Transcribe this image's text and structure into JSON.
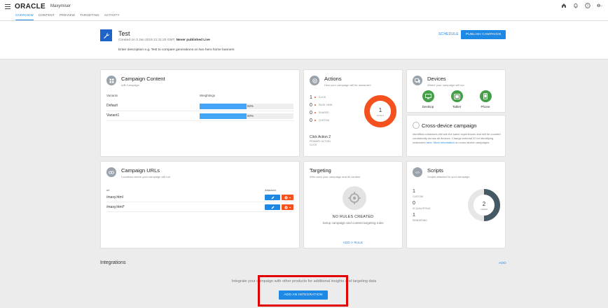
{
  "topbar": {
    "logo": "ORACLE",
    "product": "Maxymiser",
    "tabs": [
      "OVERVIEW",
      "CONTENT",
      "PREVIEW",
      "TARGETING",
      "ACTIVITY"
    ],
    "active_tab": "OVERVIEW"
  },
  "campaign": {
    "title": "Test",
    "created": "Created on 3 Jan 2019 21:11:20 GMT,",
    "status": "Never published Live",
    "description": "Enter description e.g. Test to compare generations on two hero home banners",
    "schedule_label": "SCHEDULE",
    "publish_label": "PUBLISH CAMPAIGN"
  },
  "campaign_content": {
    "title": "Campaign Content",
    "subtitle": "A/B Campaign",
    "col_variants": "Variants",
    "col_weightings": "Weightings",
    "rows": [
      {
        "name": "Default",
        "pct_label": "50%",
        "pct": 0.5
      },
      {
        "name": "Variant1",
        "pct_label": "50%",
        "pct": 0.5
      }
    ]
  },
  "actions": {
    "title": "Actions",
    "subtitle": "How your campaign will be measured",
    "rows": [
      {
        "count": "1",
        "label": "CLICK"
      },
      {
        "count": "0",
        "label": "PAGE VIEW"
      },
      {
        "count": "0",
        "label": "SHARED"
      },
      {
        "count": "0",
        "label": "CUSTOM"
      }
    ],
    "donut_value": "1",
    "donut_label": "GOALS",
    "click_action": "Click Action 2",
    "primary_label": "PRIMARY ACTION",
    "click_type": "CLICK"
  },
  "devices": {
    "title": "Devices",
    "subtitle": "Where your campaign will run",
    "items": [
      "Desktop",
      "Tablet",
      "Phone"
    ]
  },
  "cross_device": {
    "title": "Cross-device campaign",
    "text": "Identified customers will see the same experiences and will be counted consistently across all devices. Change external ID for identifying customers",
    "here_link": "here.",
    "more_link": "More information",
    "more_text": "on cross device campaigns."
  },
  "campaign_urls": {
    "title": "Campaign URLs",
    "subtitle": "Locations where your campaign will run",
    "col_url": "url",
    "col_attached": "Attached",
    "rows": [
      "/maxy.html",
      "/maxy.html*"
    ]
  },
  "targeting": {
    "title": "Targeting",
    "subtitle": "Who sees your campaign and its content",
    "no_rules": "NO RULES CREATED",
    "desc": "Setup campaign and content targeting rules",
    "add_rule": "ADD A RULE"
  },
  "scripts": {
    "title": "Scripts",
    "subtitle": "Scripts attached to your campaign",
    "icon_text": "</>",
    "rows": [
      {
        "count": "1",
        "label": "CUSTOM"
      },
      {
        "count": "0",
        "label": "IS QUALIFYING"
      },
      {
        "count": "1",
        "label": "RENDERING"
      }
    ],
    "donut_value": "2",
    "donut_label": "ADDED"
  },
  "integrations": {
    "title": "Integrations",
    "add_label": "ADD",
    "text": "Integrate your campaign with other products for additional insights and targeting data",
    "button": "ADD AN INTEGRATION"
  },
  "colors": {
    "accent": "#1e88e5",
    "donut_actions": "#f4511e",
    "donut_scripts": "#455a64",
    "devices": "#43a047",
    "highlight": "#e00000"
  }
}
